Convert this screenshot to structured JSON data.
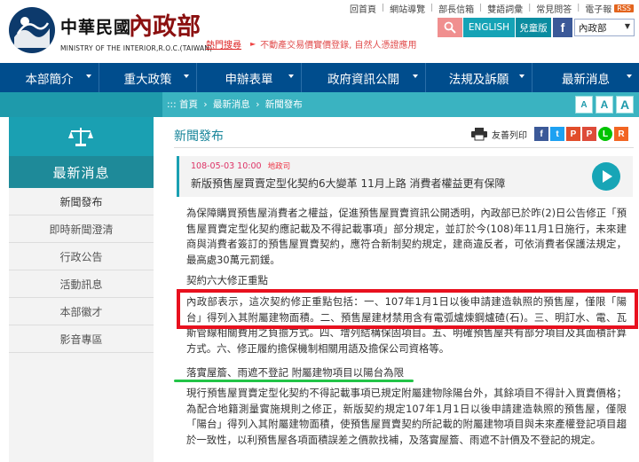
{
  "header": {
    "logo_cn": "中華民國",
    "logo_cn_red": "內政部",
    "logo_en": "MINISTRY OF THE INTERIOR,R.O.C.(TAIWAN)",
    "top_links": [
      "回首頁",
      "網站導覽",
      "部長信箱",
      "雙語詞彙",
      "常見問答",
      "電子報"
    ],
    "rss": "RSS",
    "tag_label": "熱門搜尋",
    "tag_news": "不動產交易價實價登錄, 自然人憑證應用",
    "english_btn": "ENGLISH",
    "kids_btn": "兒童版",
    "site_select": "內政部"
  },
  "nav": {
    "items": [
      "本部簡介",
      "重大政策",
      "申辦表單",
      "政府資訊公開",
      "法規及訴願",
      "最新消息"
    ]
  },
  "breadcrumb": {
    "items": [
      "首頁",
      "最新消息",
      "新聞發布"
    ],
    "sep": "›"
  },
  "font_sizes": [
    "A",
    "A",
    "A"
  ],
  "sidebar": {
    "title": "最新消息",
    "items": [
      "新聞發布",
      "即時新聞澄清",
      "行政公告",
      "活動訊息",
      "本部徽才",
      "影音專區"
    ]
  },
  "main": {
    "page_title": "新聞發布",
    "print_label": "友善列印",
    "share_icons": [
      "f",
      "t",
      "P",
      "P",
      "L",
      "R"
    ],
    "news_date": "108-05-03 10:00",
    "news_dept": "地政司",
    "news_title": "新版預售屋買賣定型化契約6大變革 11月上路 消費者權益更有保障",
    "para1": "為保障購買預售屋消費者之權益，促進預售屋買賣資訊公開透明，內政部已於昨(2)日公告修正「預售屋買賣定型化契約應記載及不得記載事項」部分規定，並訂於今(108)年11月1日施行，未來建商與消費者簽訂的預售屋買賣契約，應符合新制契約規定，建商違反者，可依消費者保護法規定，最高處30萬元罰鍰。",
    "heading1": "契約六大修正重點",
    "para2": "內政部表示，這次契約修正重點包括：一、107年1月1日以後申請建造執照的預售屋，僅限「陽台」得列入其附屬建物面積。二、預售屋建材禁用含有電弧爐煉鋼爐碴(石)。三、明訂水、電、瓦斯管線相關費用之負擔方式。四、增列結構保固項目。五、明確預售屋共有部分項目及其面積計算方式。六、修正履約擔保機制相關用語及擔保公司資格等。",
    "heading2": "落實屋簷、雨遮不登記 附屬建物項目以陽台為限",
    "para3": "現行預售屋買賣定型化契約不得記載事項已規定附屬建物除陽台外，其餘項目不得計入買賣價格；為配合地籍測量實施規則之修正，新版契約規定107年1月1日以後申請建造執照的預售屋，僅限「陽台」得列入其附屬建物面積，使預售屋買賣契約所記載的附屬建物項目與未來產權登記項目趨於一致性，以利預售屋各項面積誤差之價款找補，及落實屋簷、雨遮不計價及不登記的規定。"
  },
  "colors": {
    "nav_bg": "#004d8d",
    "accent_teal": "#1aa0b2",
    "highlight_red": "#e8101e",
    "underline_green": "#22c447"
  }
}
